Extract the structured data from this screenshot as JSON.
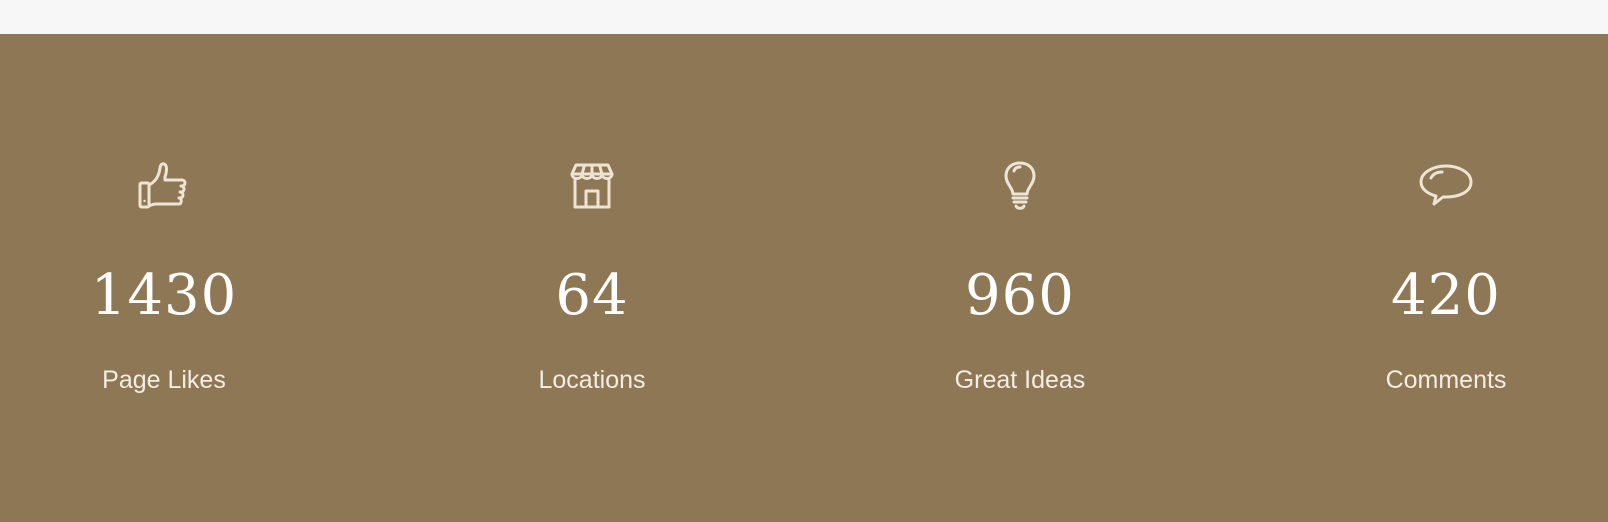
{
  "colors": {
    "top_strip": "#f7f7f7",
    "section_background": "#8e7754",
    "icon_stroke": "#ede4d6",
    "value_text": "#ffffff",
    "label_text": "#f3ede4"
  },
  "stats": [
    {
      "icon": "thumbs-up-icon",
      "value": "1430",
      "label": "Page Likes"
    },
    {
      "icon": "storefront-icon",
      "value": "64",
      "label": "Locations"
    },
    {
      "icon": "lightbulb-icon",
      "value": "960",
      "label": "Great Ideas"
    },
    {
      "icon": "speech-bubble-icon",
      "value": "420",
      "label": "Comments"
    }
  ]
}
